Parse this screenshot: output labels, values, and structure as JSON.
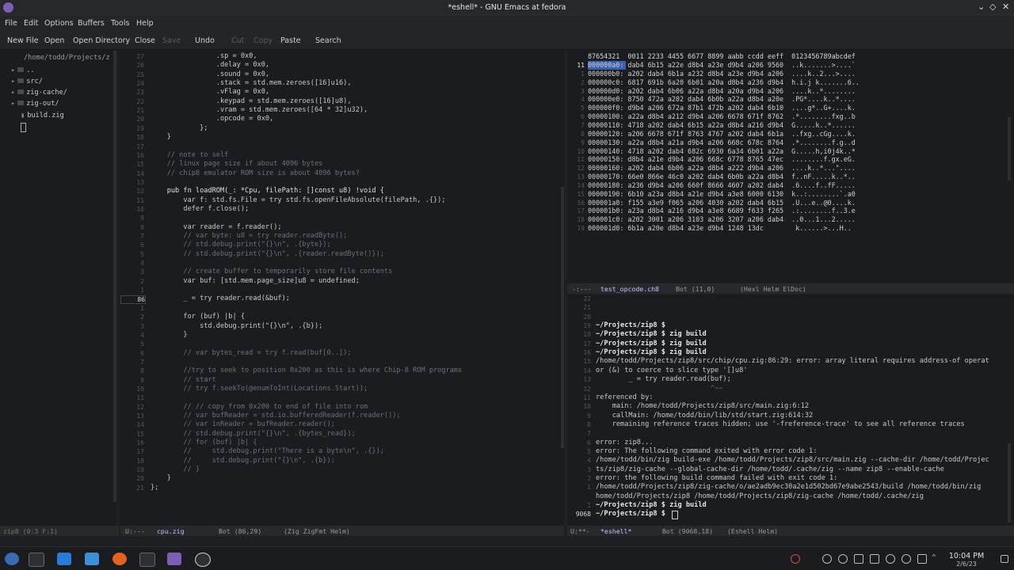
{
  "window": {
    "title": "*eshell* - GNU Emacs at fedora"
  },
  "menu": [
    "File",
    "Edit",
    "Options",
    "Buffers",
    "Tools",
    "Help"
  ],
  "toolbar": [
    {
      "label": "New File",
      "enabled": true
    },
    {
      "label": "Open",
      "enabled": true
    },
    {
      "label": "Open Directory",
      "enabled": true
    },
    {
      "label": "Close",
      "enabled": true
    },
    {
      "label": "Save",
      "enabled": false
    },
    {
      "label": "Undo",
      "enabled": true
    },
    {
      "label": "Cut",
      "enabled": false
    },
    {
      "label": "Copy",
      "enabled": false
    },
    {
      "label": "Paste",
      "enabled": true
    },
    {
      "label": "Search",
      "enabled": true
    }
  ],
  "sidebar": {
    "path": "/home/todd/Projects/z",
    "items": [
      {
        "label": "..",
        "type": "folder"
      },
      {
        "label": "src/",
        "type": "folder"
      },
      {
        "label": "zig-cache/",
        "type": "folder"
      },
      {
        "label": "zig-out/",
        "type": "folder"
      },
      {
        "label": "build.zig",
        "type": "file"
      }
    ],
    "modeline": "zip8 (0:3 F:1)"
  },
  "editor": {
    "lines": [
      {
        "n": "27",
        "t": "                .sp = 0x0,",
        "c": ""
      },
      {
        "n": "26",
        "t": "                .delay = 0x0,",
        "c": ""
      },
      {
        "n": "25",
        "t": "                .sound = 0x0,",
        "c": ""
      },
      {
        "n": "24",
        "t": "                .stack = std.mem.zeroes([16]u16),",
        "c": ""
      },
      {
        "n": "23",
        "t": "                .vFlag = 0x0,",
        "c": ""
      },
      {
        "n": "22",
        "t": "                .keypad = std.mem.zeroes([16]u8),",
        "c": ""
      },
      {
        "n": "21",
        "t": "                .vram = std.mem.zeroes([64 * 32]u32),",
        "c": ""
      },
      {
        "n": "20",
        "t": "                .opcode = 0x0,",
        "c": ""
      },
      {
        "n": "19",
        "t": "            };",
        "c": ""
      },
      {
        "n": "18",
        "t": "    }",
        "c": ""
      },
      {
        "n": "17",
        "t": "",
        "c": ""
      },
      {
        "n": "16",
        "t": "    // note to self",
        "c": "cm"
      },
      {
        "n": "15",
        "t": "    // linux page size if about 4096 bytes",
        "c": "cm"
      },
      {
        "n": "14",
        "t": "    // chip8 emulator ROM size is about 4096 bytes?",
        "c": "cm"
      },
      {
        "n": "13",
        "t": "",
        "c": ""
      },
      {
        "n": "12",
        "t": "    pub fn loadROM(_: *Cpu, filePath: []const u8) !void {",
        "c": "kw"
      },
      {
        "n": "11",
        "t": "        var f: std.fs.File = try std.fs.openFileAbsolute(filePath, .{});",
        "c": ""
      },
      {
        "n": "10",
        "t": "        defer f.close();",
        "c": ""
      },
      {
        "n": "9",
        "t": "",
        "c": ""
      },
      {
        "n": "8",
        "t": "        var reader = f.reader();",
        "c": ""
      },
      {
        "n": "7",
        "t": "        // var byte: u8 = try reader.readByte();",
        "c": "cm"
      },
      {
        "n": "6",
        "t": "        // std.debug.print(\"{}\\n\", .{byte});",
        "c": "cm"
      },
      {
        "n": "5",
        "t": "        // std.debug.print(\"{}\\n\", .{reader.readByte()});",
        "c": "cm"
      },
      {
        "n": "4",
        "t": "",
        "c": ""
      },
      {
        "n": "3",
        "t": "        // create buffer to temporarily store file contents",
        "c": "cm"
      },
      {
        "n": "2",
        "t": "        var buf: [std.mem.page_size]u8 = undefined;",
        "c": ""
      },
      {
        "n": "1",
        "t": "",
        "c": ""
      },
      {
        "n": "86",
        "t": "        _ = try reader.read(&buf);",
        "c": "cur"
      },
      {
        "n": "1",
        "t": "",
        "c": ""
      },
      {
        "n": "2",
        "t": "        for (buf) |b| {",
        "c": ""
      },
      {
        "n": "3",
        "t": "            std.debug.print(\"{}\\n\", .{b});",
        "c": ""
      },
      {
        "n": "4",
        "t": "        }",
        "c": ""
      },
      {
        "n": "5",
        "t": "",
        "c": ""
      },
      {
        "n": "6",
        "t": "        // var bytes_read = try f.read(buf[0..]);",
        "c": "cm"
      },
      {
        "n": "7",
        "t": "",
        "c": ""
      },
      {
        "n": "8",
        "t": "        //try to seek to position 0x200 as this is where Chip-8 ROM programs",
        "c": "cm"
      },
      {
        "n": "9",
        "t": "        // start",
        "c": "cm"
      },
      {
        "n": "10",
        "t": "        // try f.seekTo(@enumToInt(Locations.Start));",
        "c": "cm"
      },
      {
        "n": "11",
        "t": "",
        "c": ""
      },
      {
        "n": "12",
        "t": "        // // copy from 0x200 to end of file into rom",
        "c": "cm"
      },
      {
        "n": "13",
        "t": "        // var bufReader = std.io.bufferedReader(f.reader());",
        "c": "cm"
      },
      {
        "n": "14",
        "t": "        // var inReader = bufReader.reader();",
        "c": "cm"
      },
      {
        "n": "15",
        "t": "        // std.debug.print(\"{}\\n\", .{bytes_read});",
        "c": "cm"
      },
      {
        "n": "16",
        "t": "        // for (buf) |b| {",
        "c": "cm"
      },
      {
        "n": "17",
        "t": "        //     std.debug.print(\"There is a byte\\n\", .{});",
        "c": "cm"
      },
      {
        "n": "18",
        "t": "        //     std.debug.print(\"{}\\n\", .{b});",
        "c": "cm"
      },
      {
        "n": "19",
        "t": "        // }",
        "c": "cm"
      },
      {
        "n": "20",
        "t": "    }",
        "c": ""
      },
      {
        "n": "21",
        "t": "};",
        "c": ""
      }
    ],
    "modeline": {
      "status": "U:---",
      "buffer": "cpu.zig",
      "pos": "Bot (86,29)",
      "modes": "(Zig ZigFmt Helm)"
    }
  },
  "hexl": {
    "header": "87654321  0011 2233 4455 6677 8899 aabb ccdd eeff  0123456789abcdef",
    "rows": [
      {
        "n": "11",
        "t": "000000a0: dab4 6b15 a22e d8b4 a23e d9b4 a206 9560  ..k.......>....`"
      },
      {
        "n": "1",
        "t": "000000b0: a202 dab4 6b1a a232 d8b4 a23e d9b4 a206  ....k..2...>...."
      },
      {
        "n": "2",
        "t": "000000c0: 6817 691b 6a20 6b01 a20a d8b4 a236 d9b4  h.i.j k.......6.."
      },
      {
        "n": "3",
        "t": "000000d0: a202 dab4 6b06 a22a d8b4 a20a d9b4 a206  ....k..*........"
      },
      {
        "n": "4",
        "t": "000000e0: 8750 472a a202 dab4 6b0b a22a d8b4 a20e  .PG*....k..*...."
      },
      {
        "n": "5",
        "t": "000000f0: d9b4 a206 672a 87b1 472b a202 dab4 6b10  ....g*..G+....k."
      },
      {
        "n": "6",
        "t": "00000100: a22a d8b4 a212 d9b4 a206 6678 671f 8762  .*........fxg..b"
      },
      {
        "n": "7",
        "t": "00000110: 4718 a202 dab4 6b15 a22a d8b4 a216 d9b4  G.....k..*......"
      },
      {
        "n": "8",
        "t": "00000120: a206 6678 671f 8763 4767 a202 dab4 6b1a  ..fxg..cGg....k."
      },
      {
        "n": "9",
        "t": "00000130: a22a d8b4 a21a d9b4 a206 668c 678c 8764  .*........f.g..d"
      },
      {
        "n": "10",
        "t": "00000140: 4718 a202 dab4 682c 6930 6a34 6b01 a22a  G.....h,i0j4k..*"
      },
      {
        "n": "11",
        "t": "00000150: d8b4 a21e d9b4 a206 668c 6778 8765 47ec  ........f.gx.eG."
      },
      {
        "n": "12",
        "t": "00000160: a202 dab4 6b06 a22a d8b4 a222 d9b4 a206  ....k..*...\"...."
      },
      {
        "n": "13",
        "t": "00000170: 66e0 866e 46c0 a202 dab4 6b0b a22a d8b4  f..nF.....k..*.."
      },
      {
        "n": "14",
        "t": "00000180: a236 d9b4 a206 660f 8666 4607 a202 dab4  .6....f..fF....."
      },
      {
        "n": "15",
        "t": "00000190: 6b10 a23a d8b4 a21e d9b4 a3e8 6000 6130  k..:........`.a0"
      },
      {
        "n": "16",
        "t": "000001a0: f155 a3e9 f065 a206 4030 a202 dab4 6b15  .U...e..@0....k."
      },
      {
        "n": "17",
        "t": "000001b0: a23a d8b4 a216 d9b4 a3e8 6689 f633 f265  .:........f..3.e"
      },
      {
        "n": "18",
        "t": "000001c0: a202 3001 a206 3103 a206 3207 a206 dab4  ..0...1...2....."
      },
      {
        "n": "19",
        "t": "000001d0: 6b1a a20e d8b4 a23e d9b4 1248 13dc        k......>...H.."
      }
    ],
    "modeline": {
      "status": "-:---",
      "buffer": "test_opcode.ch8",
      "pos": "Bot (11,0)",
      "modes": "(Hexl Helm ElDoc)"
    }
  },
  "eshell": {
    "lines": [
      {
        "n": "22",
        "t": "",
        "c": ""
      },
      {
        "n": "21",
        "t": "",
        "c": ""
      },
      {
        "n": "20",
        "t": "",
        "c": ""
      },
      {
        "n": "19",
        "t": "~/Projects/zip8 $",
        "c": "p"
      },
      {
        "n": "18",
        "t": "~/Projects/zip8 $ zig build",
        "c": "p"
      },
      {
        "n": "17",
        "t": "~/Projects/zip8 $ zig build",
        "c": "p"
      },
      {
        "n": "16",
        "t": "~/Projects/zip8 $ zig build",
        "c": "p"
      },
      {
        "n": "15",
        "t": "/home/todd/Projects/zip8/src/chip/cpu.zig:86:29: error: array literal requires address-of operat",
        "c": ""
      },
      {
        "n": "14",
        "t": "or (&) to coerce to slice type '[]u8'",
        "c": ""
      },
      {
        "n": "13",
        "t": "        _ = try reader.read(buf);",
        "c": ""
      },
      {
        "n": "12",
        "t": "                            ^~~",
        "c": "cm"
      },
      {
        "n": "11",
        "t": "referenced by:",
        "c": ""
      },
      {
        "n": "10",
        "t": "    main: /home/todd/Projects/zip8/src/main.zig:6:12",
        "c": ""
      },
      {
        "n": "9",
        "t": "    callMain: /home/todd/bin/lib/std/start.zig:614:32",
        "c": ""
      },
      {
        "n": "8",
        "t": "    remaining reference traces hidden; use '-freference-trace' to see all reference traces",
        "c": ""
      },
      {
        "n": "7",
        "t": "",
        "c": ""
      },
      {
        "n": "6",
        "t": "error: zip8...",
        "c": ""
      },
      {
        "n": "5",
        "t": "error: The following command exited with error code 1:",
        "c": ""
      },
      {
        "n": "4",
        "t": "/home/todd/bin/zig build-exe /home/todd/Projects/zip8/src/main.zig --cache-dir /home/todd/Projec",
        "c": ""
      },
      {
        "n": "3",
        "t": "ts/zip8/zig-cache --global-cache-dir /home/todd/.cache/zig --name zip8 --enable-cache",
        "c": ""
      },
      {
        "n": "2",
        "t": "error: the following build command failed with exit code 1:",
        "c": ""
      },
      {
        "n": "1",
        "t": "/home/todd/Projects/zip8/zig-cache/o/ae2adb9ec30a2e1d502bd67e9abe2543/build /home/todd/bin/zig",
        "c": ""
      },
      {
        "n": "",
        "t": "home/todd/Projects/zip8 /home/todd/Projects/zip8/zig-cache /home/todd/.cache/zig",
        "c": ""
      },
      {
        "n": "1",
        "t": "~/Projects/zip8 $ zig build",
        "c": "p"
      },
      {
        "n": "9068",
        "t": "~/Projects/zip8 $ ",
        "c": "pc"
      }
    ],
    "modeline": {
      "status": "U:**-",
      "buffer": "*eshell*",
      "pos": "Bot (9068,18)",
      "modes": "(Eshell Helm)"
    }
  },
  "clock": {
    "time": "10:04 PM",
    "date": "2/6/23"
  },
  "colors": {
    "accent": "#c9c1ff",
    "comment": "#6e6f78",
    "keyword": "#c4a7e7",
    "prompt": "#8fb8ff"
  }
}
